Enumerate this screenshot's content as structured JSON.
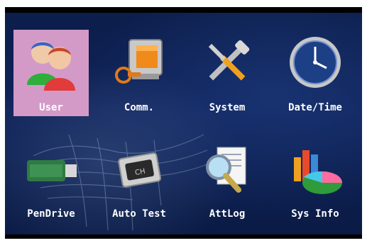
{
  "menu": {
    "items": [
      {
        "label": "User",
        "icon": "user-icon",
        "selected": true
      },
      {
        "label": "Comm.",
        "icon": "communication-icon",
        "selected": false
      },
      {
        "label": "System",
        "icon": "system-tools-icon",
        "selected": false
      },
      {
        "label": "Date/Time",
        "icon": "clock-icon",
        "selected": false
      },
      {
        "label": "PenDrive",
        "icon": "usb-drive-icon",
        "selected": false
      },
      {
        "label": "Auto Test",
        "icon": "chip-icon",
        "selected": false
      },
      {
        "label": "AttLog",
        "icon": "log-search-icon",
        "selected": false
      },
      {
        "label": "Sys Info",
        "icon": "chart-icon",
        "selected": false
      }
    ]
  },
  "colors": {
    "background": "#10245a",
    "selected": "#d39ac8",
    "label": "#ffffff"
  }
}
